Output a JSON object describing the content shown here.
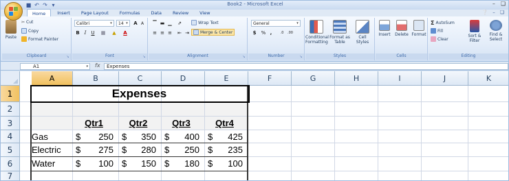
{
  "window": {
    "title": "Book2 - Microsoft Excel"
  },
  "tabs": [
    "Home",
    "Insert",
    "Page Layout",
    "Formulas",
    "Data",
    "Review",
    "View"
  ],
  "active_tab": "Home",
  "ribbon": {
    "clipboard": {
      "paste": "Paste",
      "cut": "Cut",
      "copy": "Copy",
      "format_painter": "Format Painter",
      "label": "Clipboard"
    },
    "font": {
      "name": "Calibri",
      "size": "14",
      "label": "Font",
      "bold": "B",
      "italic": "I",
      "underline": "U",
      "grow": "A",
      "shrink": "A"
    },
    "alignment": {
      "wrap": "Wrap Text",
      "merge": "Merge & Center",
      "label": "Alignment"
    },
    "number": {
      "format": "General",
      "currency": "$",
      "percent": "%",
      "comma": ",",
      "label": "Number"
    },
    "styles": {
      "conditional": "Conditional Formatting",
      "format_table": "Format as Table",
      "cell_styles": "Cell Styles",
      "label": "Styles"
    },
    "cells": {
      "insert": "Insert",
      "delete": "Delete",
      "format": "Format",
      "label": "Cells"
    },
    "editing": {
      "autosum": "AutoSum",
      "fill": "Fill",
      "clear": "Clear",
      "sort": "Sort & Filter",
      "find": "Find & Select",
      "label": "Editing"
    }
  },
  "formula_bar": {
    "name_box": "A1",
    "fx": "fx",
    "content": "Expenses"
  },
  "columns": [
    "A",
    "B",
    "C",
    "D",
    "E",
    "F",
    "G",
    "H",
    "I",
    "J",
    "K"
  ],
  "rows": [
    "1",
    "2",
    "3",
    "4",
    "5",
    "6",
    "7"
  ],
  "sheet": {
    "title": "Expenses",
    "quarters": [
      "Qtr1",
      "Qtr2",
      "Qtr3",
      "Qtr4"
    ],
    "currency_symbol": "$",
    "items": [
      {
        "name": "Gas",
        "values": [
          "250",
          "350",
          "400",
          "425"
        ]
      },
      {
        "name": "Electric",
        "values": [
          "275",
          "280",
          "250",
          "235"
        ]
      },
      {
        "name": "Water",
        "values": [
          "100",
          "150",
          "180",
          "100"
        ]
      }
    ]
  },
  "colors": {
    "accent": "#15428b",
    "selection": "#f1c15f"
  }
}
